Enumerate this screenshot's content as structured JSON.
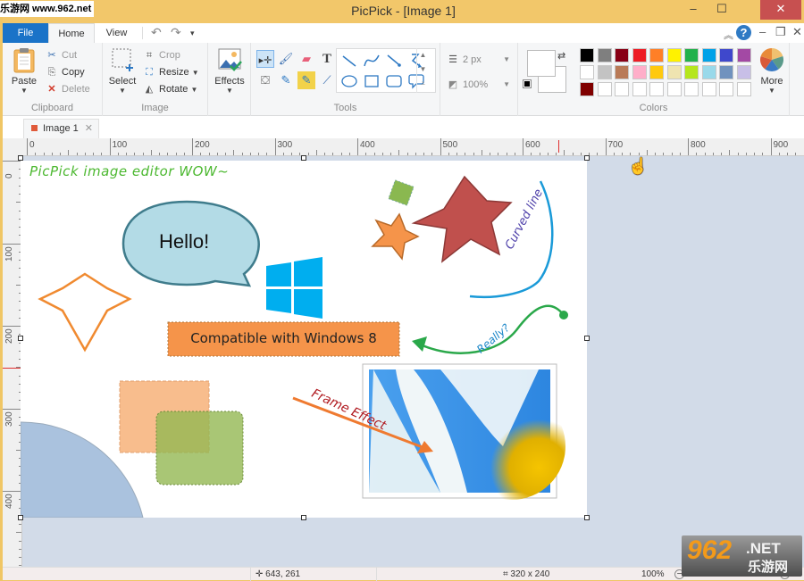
{
  "watermark": "乐游网 www.962.net",
  "window": {
    "title": "PicPick - [Image 1]",
    "controls": {
      "minimize": "–",
      "maximize": "☐",
      "close": "✕"
    }
  },
  "ribbon_tabs": [
    {
      "label": "File",
      "active": false
    },
    {
      "label": "Home",
      "active": true
    },
    {
      "label": "View",
      "active": false
    }
  ],
  "quick_access": {
    "undo": "↶",
    "redo": "↷",
    "more": "▾"
  },
  "ribbon_right": {
    "collapse": "︽",
    "help": "?",
    "minimize": "–",
    "restore": "❐",
    "close": "✕"
  },
  "clipboard": {
    "label": "Clipboard",
    "paste": "Paste",
    "cut": "Cut",
    "copy": "Copy",
    "delete": "Delete"
  },
  "image_group": {
    "label": "Image",
    "select": "Select",
    "crop": "Crop",
    "resize": "Resize",
    "rotate": "Rotate"
  },
  "effects": {
    "label": "Effects"
  },
  "tools": {
    "label": "Tools",
    "items": [
      "select-move",
      "brush",
      "eraser",
      "text",
      "fill",
      "pen",
      "highlighter",
      "color-picker"
    ],
    "text_glyph": "T",
    "shapes": [
      "line",
      "curve",
      "arrow",
      "curved-arrow",
      "ellipse",
      "rectangle",
      "rounded-rectangle",
      "callout"
    ]
  },
  "stroke": {
    "width": "2 px",
    "opacity": "100%"
  },
  "colors": {
    "label": "Colors",
    "primary": "#ffffff",
    "secondary": "#ffffff",
    "palette": [
      [
        "#000000",
        "#7f7f7f",
        "#880015",
        "#ed1c24",
        "#ff7f27",
        "#fff200",
        "#22b14c",
        "#00a2e8",
        "#3f48cc",
        "#a349a4"
      ],
      [
        "#ffffff",
        "#c3c3c3",
        "#b97a57",
        "#ffaec9",
        "#ffc90e",
        "#efe4b0",
        "#b5e61d",
        "#99d9ea",
        "#7092be",
        "#c8bfe7"
      ],
      [
        "#800000",
        "#ffffff",
        "#ffffff",
        "#ffffff",
        "#ffffff",
        "#ffffff",
        "#ffffff",
        "#ffffff",
        "#ffffff",
        "#ffffff"
      ]
    ],
    "more": "More"
  },
  "document_tab": {
    "label": "Image 1",
    "close": "✕"
  },
  "ruler": {
    "horizontal": [
      "0",
      "100",
      "200",
      "300",
      "400",
      "500",
      "600",
      "700",
      "800",
      "900"
    ],
    "vertical": [
      "0",
      "100",
      "200",
      "300",
      "400"
    ]
  },
  "canvas": {
    "heading": "PicPick image editor WOW~",
    "bubble": "Hello!",
    "banner": "Compatible with Windows 8",
    "curved_label": "Curved line",
    "really_label": "Really?",
    "frame_label": "Frame Effect"
  },
  "status": {
    "cursor": "643, 261",
    "selection": "320 x 240",
    "zoom": "100%"
  },
  "logo": {
    "number": "962",
    "suffix": ".NET",
    "cn": "乐游网"
  }
}
